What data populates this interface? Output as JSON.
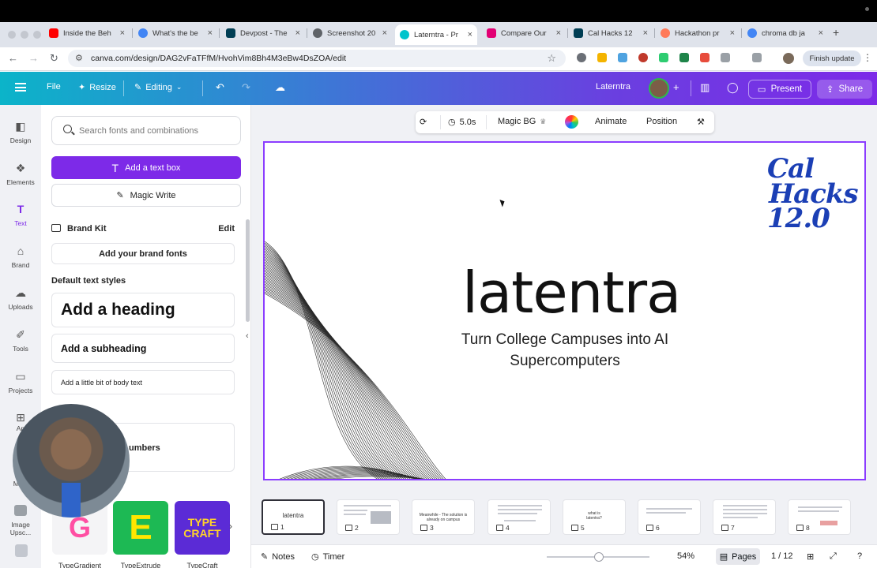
{
  "browser": {
    "tabs": [
      {
        "label": "Inside the Beh",
        "color": "#ff0000"
      },
      {
        "label": "What's the be",
        "color": "#4285f4"
      },
      {
        "label": "Devpost - The",
        "color": "#003e54"
      },
      {
        "label": "Screenshot 20",
        "color": "#5f6368"
      },
      {
        "label": "Laterntra - Pr",
        "color": "#00c4cc"
      },
      {
        "label": "Compare Our",
        "color": "#e20074"
      },
      {
        "label": "Cal Hacks 12",
        "color": "#003e54"
      },
      {
        "label": "Hackathon pr",
        "color": "#ff7a59"
      },
      {
        "label": "chroma db ja",
        "color": "#4285f4"
      }
    ],
    "url": "canva.com/design/DAG2vFaTFfM/HvohVim8Bh4M3eBw4DsZOA/edit",
    "finish_update": "Finish update"
  },
  "header": {
    "file": "File",
    "resize": "Resize",
    "editing": "Editing",
    "project_name": "Laterntra",
    "present": "Present",
    "share": "Share"
  },
  "rail": [
    {
      "label": "Design",
      "icon": "design-icon"
    },
    {
      "label": "Elements",
      "icon": "elements-icon"
    },
    {
      "label": "Text",
      "icon": "text-icon"
    },
    {
      "label": "Brand",
      "icon": "brand-icon"
    },
    {
      "label": "Uploads",
      "icon": "uploads-icon"
    },
    {
      "label": "Tools",
      "icon": "tools-icon"
    },
    {
      "label": "Projects",
      "icon": "projects-icon"
    },
    {
      "label": "Ap",
      "icon": "apps-icon"
    },
    {
      "label": "Magi",
      "icon": "magic-icon"
    },
    {
      "label": "Image Upsc...",
      "icon": "image-upscaler-icon"
    }
  ],
  "panel": {
    "search_placeholder": "Search fonts and combinations",
    "add_text_box": "Add a text box",
    "magic_write": "Magic Write",
    "brand_kit": "Brand Kit",
    "edit": "Edit",
    "add_brand_fonts": "Add your brand fonts",
    "default_styles": "Default text styles",
    "heading": "Add a heading",
    "subheading": "Add a subheading",
    "body": "Add a little bit of body text",
    "numbers": "umbers",
    "font_tiles": [
      {
        "label": "TypeGradient",
        "glyph": "G"
      },
      {
        "label": "TypeExtrude",
        "glyph": "E"
      },
      {
        "label": "TypeCraft",
        "glyph": "TYPE CRAFT"
      }
    ]
  },
  "toolbar": {
    "duration": "5.0s",
    "magic_bg": "Magic BG",
    "animate": "Animate",
    "position": "Position"
  },
  "slide": {
    "logo": [
      "Cal",
      "Hacks",
      "12.0"
    ],
    "title": "latentra",
    "subtitle": "Turn College Campuses into AI Supercomputers"
  },
  "thumbnails": [
    {
      "n": "1",
      "text": "latentra"
    },
    {
      "n": "2",
      "text": ""
    },
    {
      "n": "3",
      "text": "Meanwhile - The solution is already on campus"
    },
    {
      "n": "4",
      "text": ""
    },
    {
      "n": "5",
      "text": "what is latentra?"
    },
    {
      "n": "6",
      "text": ""
    },
    {
      "n": "7",
      "text": ""
    },
    {
      "n": "8",
      "text": ""
    }
  ],
  "bottom": {
    "notes": "Notes",
    "timer": "Timer",
    "zoom": "54%",
    "pages": "Pages",
    "page_count": "1 / 12"
  }
}
